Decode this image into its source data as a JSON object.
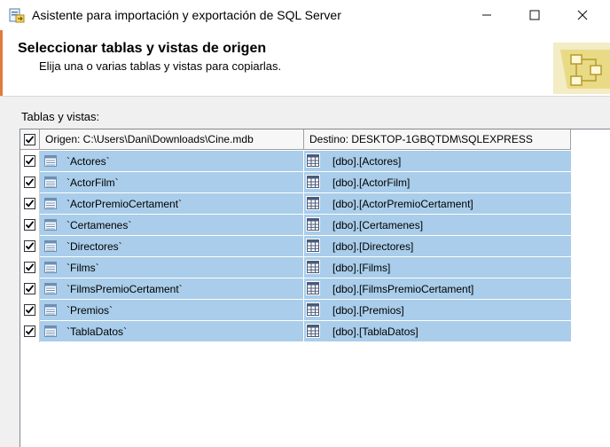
{
  "window": {
    "title": "Asistente para importación y exportación de SQL Server",
    "minimize": "—",
    "maximize": "☐",
    "close": "✕"
  },
  "header": {
    "title": "Seleccionar tablas y vistas de origen",
    "subtitle": "Elija una o varias tablas y vistas para copiarlas."
  },
  "section": {
    "label": "Tablas y vistas:"
  },
  "grid": {
    "columns": {
      "source": "Origen: C:\\Users\\Dani\\Downloads\\Cine.mdb",
      "destination": "Destino: DESKTOP-1GBQTDM\\SQLEXPRESS"
    },
    "header_checked": true,
    "rows": [
      {
        "checked": true,
        "source": "`Actores`",
        "destination": "[dbo].[Actores]"
      },
      {
        "checked": true,
        "source": "`ActorFilm`",
        "destination": "[dbo].[ActorFilm]"
      },
      {
        "checked": true,
        "source": "`ActorPremioCertament`",
        "destination": "[dbo].[ActorPremioCertament]"
      },
      {
        "checked": true,
        "source": "`Certamenes`",
        "destination": "[dbo].[Certamenes]"
      },
      {
        "checked": true,
        "source": "`Directores`",
        "destination": "[dbo].[Directores]"
      },
      {
        "checked": true,
        "source": "`Films`",
        "destination": "[dbo].[Films]"
      },
      {
        "checked": true,
        "source": "`FilmsPremioCertament`",
        "destination": "[dbo].[FilmsPremioCertament]"
      },
      {
        "checked": true,
        "source": "`Premios`",
        "destination": "[dbo].[Premios]"
      },
      {
        "checked": true,
        "source": "`TablaDatos`",
        "destination": "[dbo].[TablaDatos]"
      }
    ]
  },
  "icons": {
    "app": "sql-wizard-icon",
    "header_graphic": "flowchart-icon",
    "source_row": "table-icon",
    "destination_row": "table-grid-icon"
  },
  "colors": {
    "selection": "#a9cdea",
    "accent_edge": "#e07b39"
  }
}
